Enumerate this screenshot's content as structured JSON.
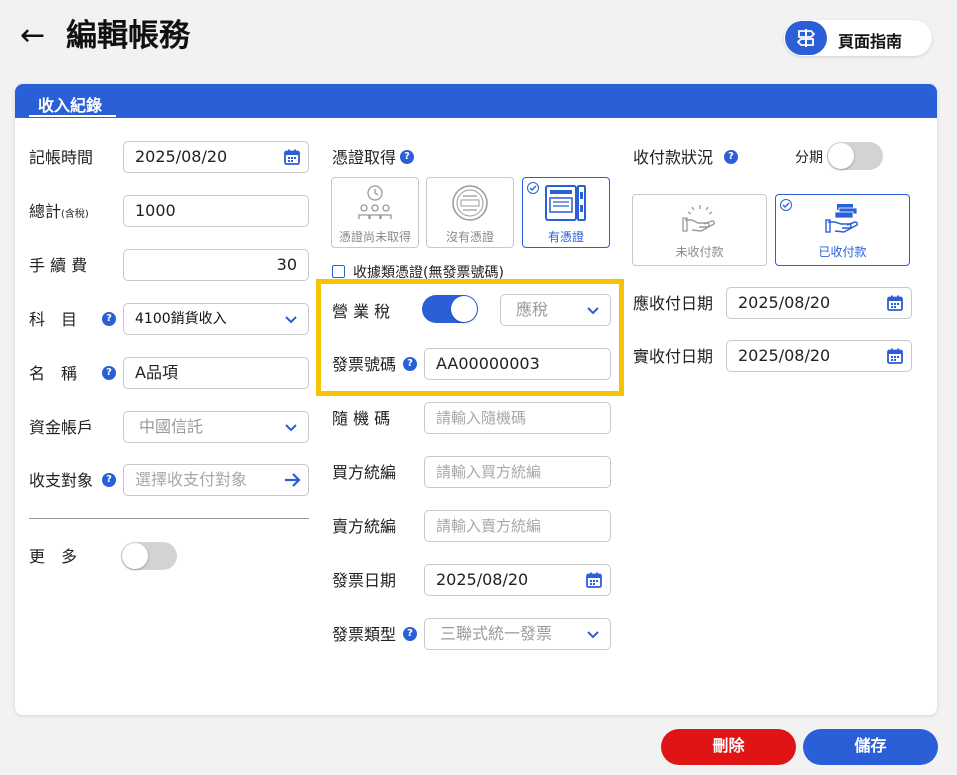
{
  "header": {
    "back_icon": "←",
    "title": "編輯帳務",
    "guide_label": "頁面指南"
  },
  "card": {
    "tab_label": "收入紀錄"
  },
  "left": {
    "date_label": "記帳時間",
    "date_value": "2025/08/20",
    "total_label": "總計",
    "total_sub": "(含稅)",
    "total_value": "1000",
    "fee_label": "手 續 費",
    "fee_value": "30",
    "subject_label": "科　目",
    "subject_value": "4100銷貨收入",
    "name_label": "名　稱",
    "name_value": "A品項",
    "account_label": "資金帳戶",
    "account_value": "中國信託",
    "target_label": "收支對象",
    "target_placeholder": "選擇收支付對象",
    "more_label": "更　多"
  },
  "middle": {
    "voucher_label": "憑證取得",
    "voucher_options": [
      {
        "label": "憑證尚未取得"
      },
      {
        "label": "沒有憑證"
      },
      {
        "label": "有憑證"
      }
    ],
    "receipt_checkbox_label": "收據類憑證(無發票號碼)",
    "tax_label": "營 業 稅",
    "tax_select_value": "應稅",
    "invoice_no_label": "發票號碼",
    "invoice_no_value": "AA00000003",
    "random_label": "隨 機 碼",
    "random_placeholder": "請輸入隨機碼",
    "buyer_label": "買方統編",
    "buyer_placeholder": "請輸入買方統編",
    "seller_label": "賣方統編",
    "seller_placeholder": "請輸入賣方統編",
    "invoice_date_label": "發票日期",
    "invoice_date_value": "2025/08/20",
    "invoice_type_label": "發票類型",
    "invoice_type_value": "三聯式統一發票"
  },
  "right": {
    "payment_status_label": "收付款狀況",
    "installment_label": "分期",
    "payment_options": [
      {
        "label": "未收付款"
      },
      {
        "label": "已收付款"
      }
    ],
    "due_date_label": "應收付日期",
    "due_date_value": "2025/08/20",
    "actual_date_label": "實收付日期",
    "actual_date_value": "2025/08/20"
  },
  "footer": {
    "delete_label": "刪除",
    "save_label": "儲存"
  },
  "colors": {
    "primary": "#2a5fd8",
    "danger": "#e01414",
    "highlight": "#f5c400"
  }
}
